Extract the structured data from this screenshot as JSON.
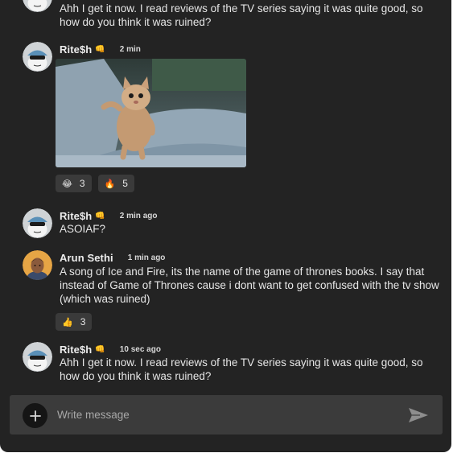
{
  "messages": [
    {
      "author": "",
      "author_emoji": "",
      "time": "",
      "text": "Ahh I get it now. I read reviews of the TV series saying it was quite good, so how do you think it was ruined?"
    },
    {
      "author": "Rite$h",
      "author_emoji": "👊",
      "time": "2 min",
      "attachment_icon": "kitten-photo",
      "reactions": [
        {
          "emoji": "😂",
          "count": "3"
        },
        {
          "emoji": "🔥",
          "count": "5"
        }
      ]
    },
    {
      "author": "Rite$h",
      "author_emoji": "👊",
      "time": "2 min ago",
      "text": "ASOIAF?"
    },
    {
      "author": "Arun Sethi",
      "time": "1 min ago",
      "text": "A song of Ice and Fire, its the name of the game of thrones books. I say that instead of Game of Thrones cause i dont want to get confused with the tv show (which was ruined)",
      "reactions": [
        {
          "emoji": "👍",
          "count": "3"
        }
      ]
    },
    {
      "author": "Rite$h",
      "author_emoji": "👊",
      "time": "10 sec ago",
      "text": "Ahh I get it now. I read reviews of the TV series saying it was quite good, so how do you think it was ruined?"
    }
  ],
  "composer": {
    "placeholder": "Write message",
    "add_icon": "plus-icon",
    "send_icon": "send-icon"
  },
  "colors": {
    "background": "#232323",
    "composer": "#3b3b3b",
    "reaction_chip": "#3a3a3a"
  }
}
